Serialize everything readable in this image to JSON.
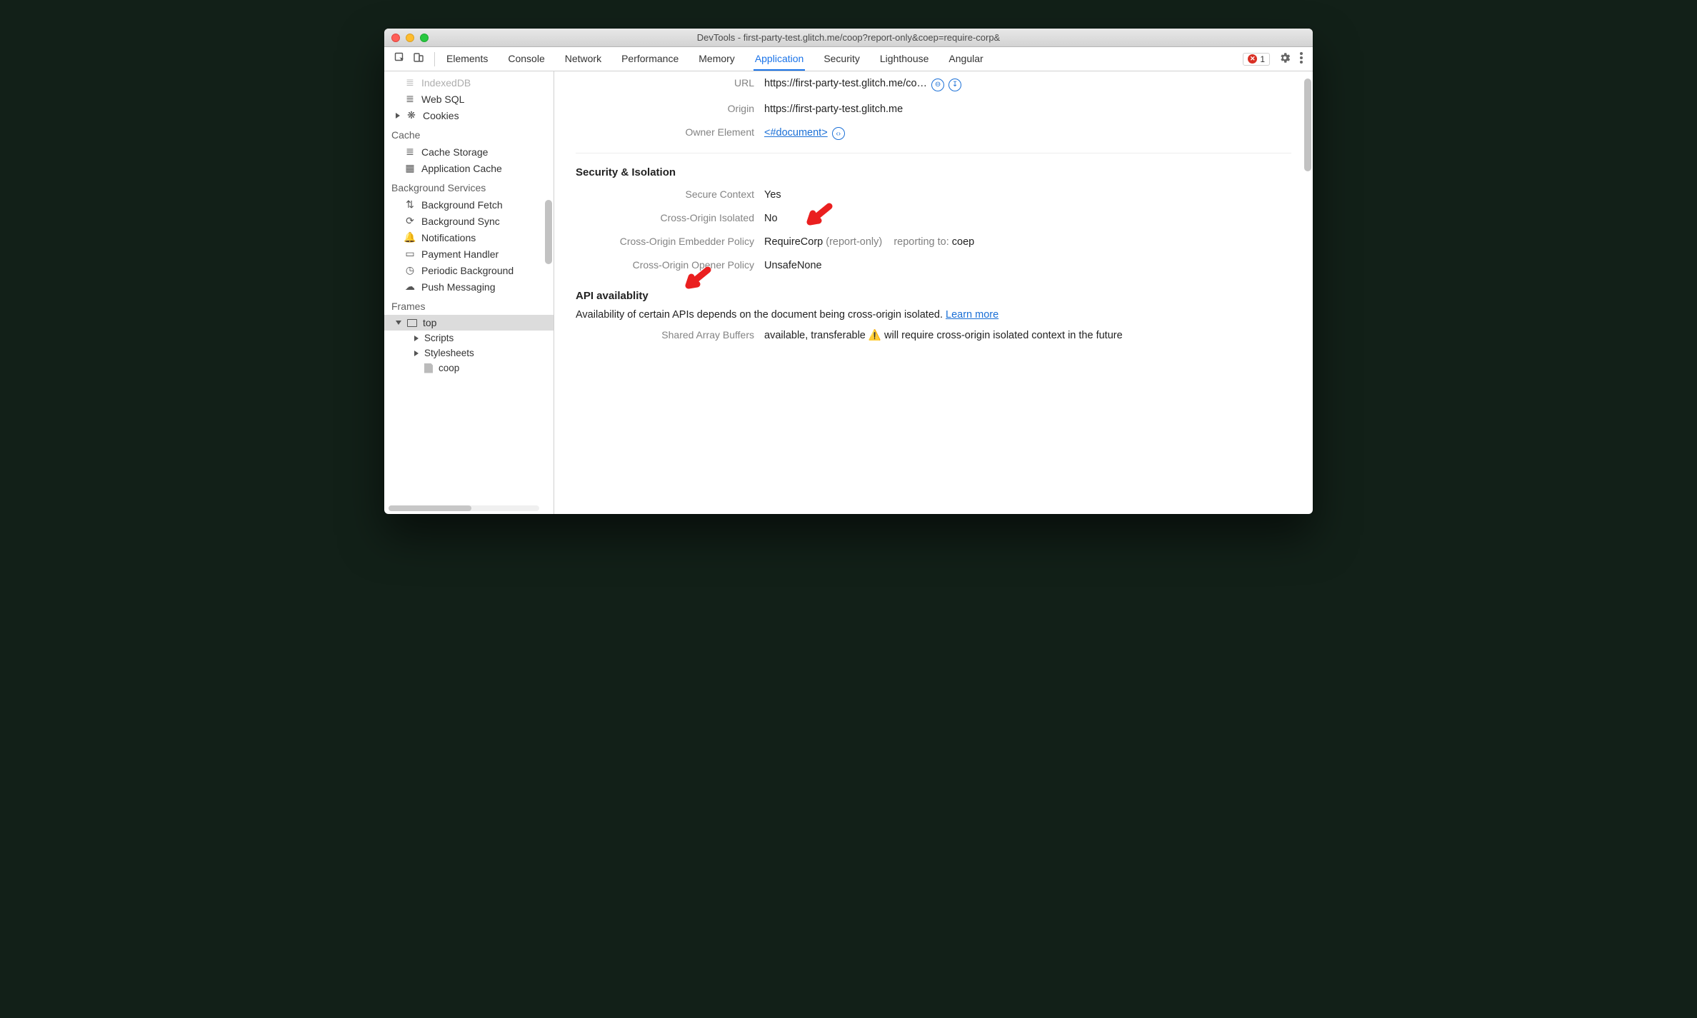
{
  "window": {
    "title": "DevTools - first-party-test.glitch.me/coop?report-only&coep=require-corp&"
  },
  "tabs": {
    "elements": "Elements",
    "console": "Console",
    "network": "Network",
    "performance": "Performance",
    "memory": "Memory",
    "application": "Application",
    "security": "Security",
    "lighthouse": "Lighthouse",
    "angular": "Angular"
  },
  "errors": {
    "count": "1"
  },
  "sidebar": {
    "indexeddb": "IndexedDB",
    "websql": "Web SQL",
    "cookies": "Cookies",
    "groupCache": "Cache",
    "cacheStorage": "Cache Storage",
    "appCache": "Application Cache",
    "groupBg": "Background Services",
    "bgFetch": "Background Fetch",
    "bgSync": "Background Sync",
    "notif": "Notifications",
    "payment": "Payment Handler",
    "periodic": "Periodic Background",
    "push": "Push Messaging",
    "groupFrames": "Frames",
    "top": "top",
    "scripts": "Scripts",
    "stylesheets": "Stylesheets",
    "coop": "coop"
  },
  "detail": {
    "url_label": "URL",
    "url_value": "https://first-party-test.glitch.me/co…",
    "origin_label": "Origin",
    "origin_value": "https://first-party-test.glitch.me",
    "owner_label": "Owner Element",
    "owner_link": "<#document>",
    "sec_heading": "Security & Isolation",
    "secctx_label": "Secure Context",
    "secctx_value": "Yes",
    "coi_label": "Cross-Origin Isolated",
    "coi_value": "No",
    "coep_label": "Cross-Origin Embedder Policy",
    "coep_value": "RequireCorp",
    "coep_aside": "(report-only)",
    "coep_reporting": "reporting to:",
    "coep_endpoint": "coep",
    "coop_label": "Cross-Origin Opener Policy",
    "coop_value": "UnsafeNone",
    "api_heading": "API availablity",
    "api_desc_a": "Availability of certain APIs depends on the document being cross-origin isolated. ",
    "api_learn": "Learn more",
    "sab_label": "Shared Array Buffers",
    "sab_value": "available, transferable",
    "sab_warn": "will require cross-origin isolated context in the future"
  }
}
